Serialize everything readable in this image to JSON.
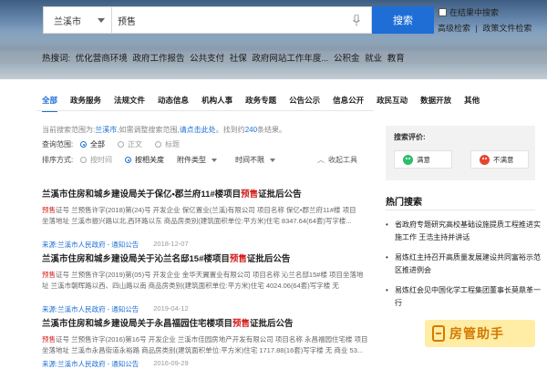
{
  "header": {
    "region": "兰溪市",
    "search_value": "预售",
    "search_button": "搜索",
    "in_result_label": "在结果中搜索",
    "advanced_search": "高级检索",
    "policy_search": "政策文件检索",
    "hot_label": "热搜词:",
    "hot_words": [
      "优化营商环境",
      "政府工作报告",
      "公共支付",
      "社保",
      "政府网站工作年度...",
      "公积金",
      "就业",
      "教育"
    ]
  },
  "tabs": [
    "全部",
    "政务服务",
    "法规文件",
    "动态信息",
    "机构人事",
    "政务专题",
    "公告公示",
    "信息公开",
    "政民互动",
    "数据开放",
    "其他"
  ],
  "active_tab": "全部",
  "hint": {
    "prefix": "当前搜索范围为:",
    "region": "兰溪市",
    "middle": ",如需调整搜索范围,",
    "link": "请点击此处",
    "suffix": "。找到约",
    "count": "240",
    "end": "条结果。"
  },
  "filters": {
    "scope_label": "查询范围:",
    "scope_options": [
      "全部",
      "正文",
      "标题"
    ],
    "sort_label": "排序方式:",
    "sort_options": [
      "按时间",
      "按相关度"
    ],
    "attachment": "附件类型",
    "time": "时间不限",
    "collapse": "收起工具"
  },
  "results": [
    {
      "title_pre": "兰溪市住房和城乡建设局关于保亿•郡兰府11#楼项目",
      "title_hl": "预售",
      "title_post": "证批后公告",
      "body_l1_hl": "预售",
      "body_l1": "证号 兰预售许字(2018)第(24)号 开发企业 保亿置业(兰溪)有限公司 项目名称 保亿•郡兰府11#楼 项目",
      "body_l2": "坐落地址 兰溪市振兴路以北,西环路以东 商品房类别(建筑面积单位:平方米)住宅 8347.64(64套)写字楼...",
      "body_l3": "",
      "source": "来源:兰溪市人民政府 - 通知公告",
      "date": "2018-12-07"
    },
    {
      "title_pre": "兰溪市住房和城乡建设局关于沁兰名邸15#楼项目",
      "title_hl": "预售",
      "title_post": "证批后公告",
      "body_l1_pre": "",
      "body_l1_hl": "预售",
      "body_l1": "证号 兰预售许字(2019)第(05)号 开发企业 金华天翼置业有限公司 项目名称 沁兰名邸15#楼 项目坐落地",
      "body_l2": "址 兰溪市朝晖路以西、四山路以南 商品房类别(建筑面积单位:平方米)住宅 4024.06(64套)写字楼 无",
      "body_l3": "",
      "source": "来源:兰溪市人民政府 - 通知公告",
      "date": "2019-04-12"
    },
    {
      "title_pre": "兰溪市住房和城乡建设局关于永昌福园住宅楼项目",
      "title_hl": "预售",
      "title_post": "证批后公告",
      "body_l1_hl": "预售",
      "body_l1": "证号 兰预售许字(2016)第16号 开发企业 兰溪市佳园房地产开发有限公司 项目名称 永昌福园住宅楼 项目",
      "body_l2": "坐落地址 兰溪市永昌街道永裕路 商品房类别(建筑面积单位:平方米)住宅 1717.88(16套)写字楼 无 商业 53...",
      "body_l3": "",
      "source": "来源:兰溪市人民政府 - 通知公告",
      "date": "2016-09-29"
    }
  ],
  "side": {
    "eval_title": "搜索评价:",
    "satisfied": "满意",
    "unsatisfied": "不满意",
    "hot_title": "热门搜索",
    "hot_items": [
      "省政府专题研究高校基础设施提质工程推进实施工作 王浩主持并讲话",
      "易炼红主持召开高质量发展建设共同富裕示范区推进例会",
      "易炼红会见中国化学工程集团董事长莫鼎革一行"
    ]
  },
  "watermark": "房管助手",
  "colors": {
    "accent": "#1e6ed6",
    "highlight": "#d42222",
    "good": "#2ebd6b",
    "bad": "#e8452f"
  }
}
